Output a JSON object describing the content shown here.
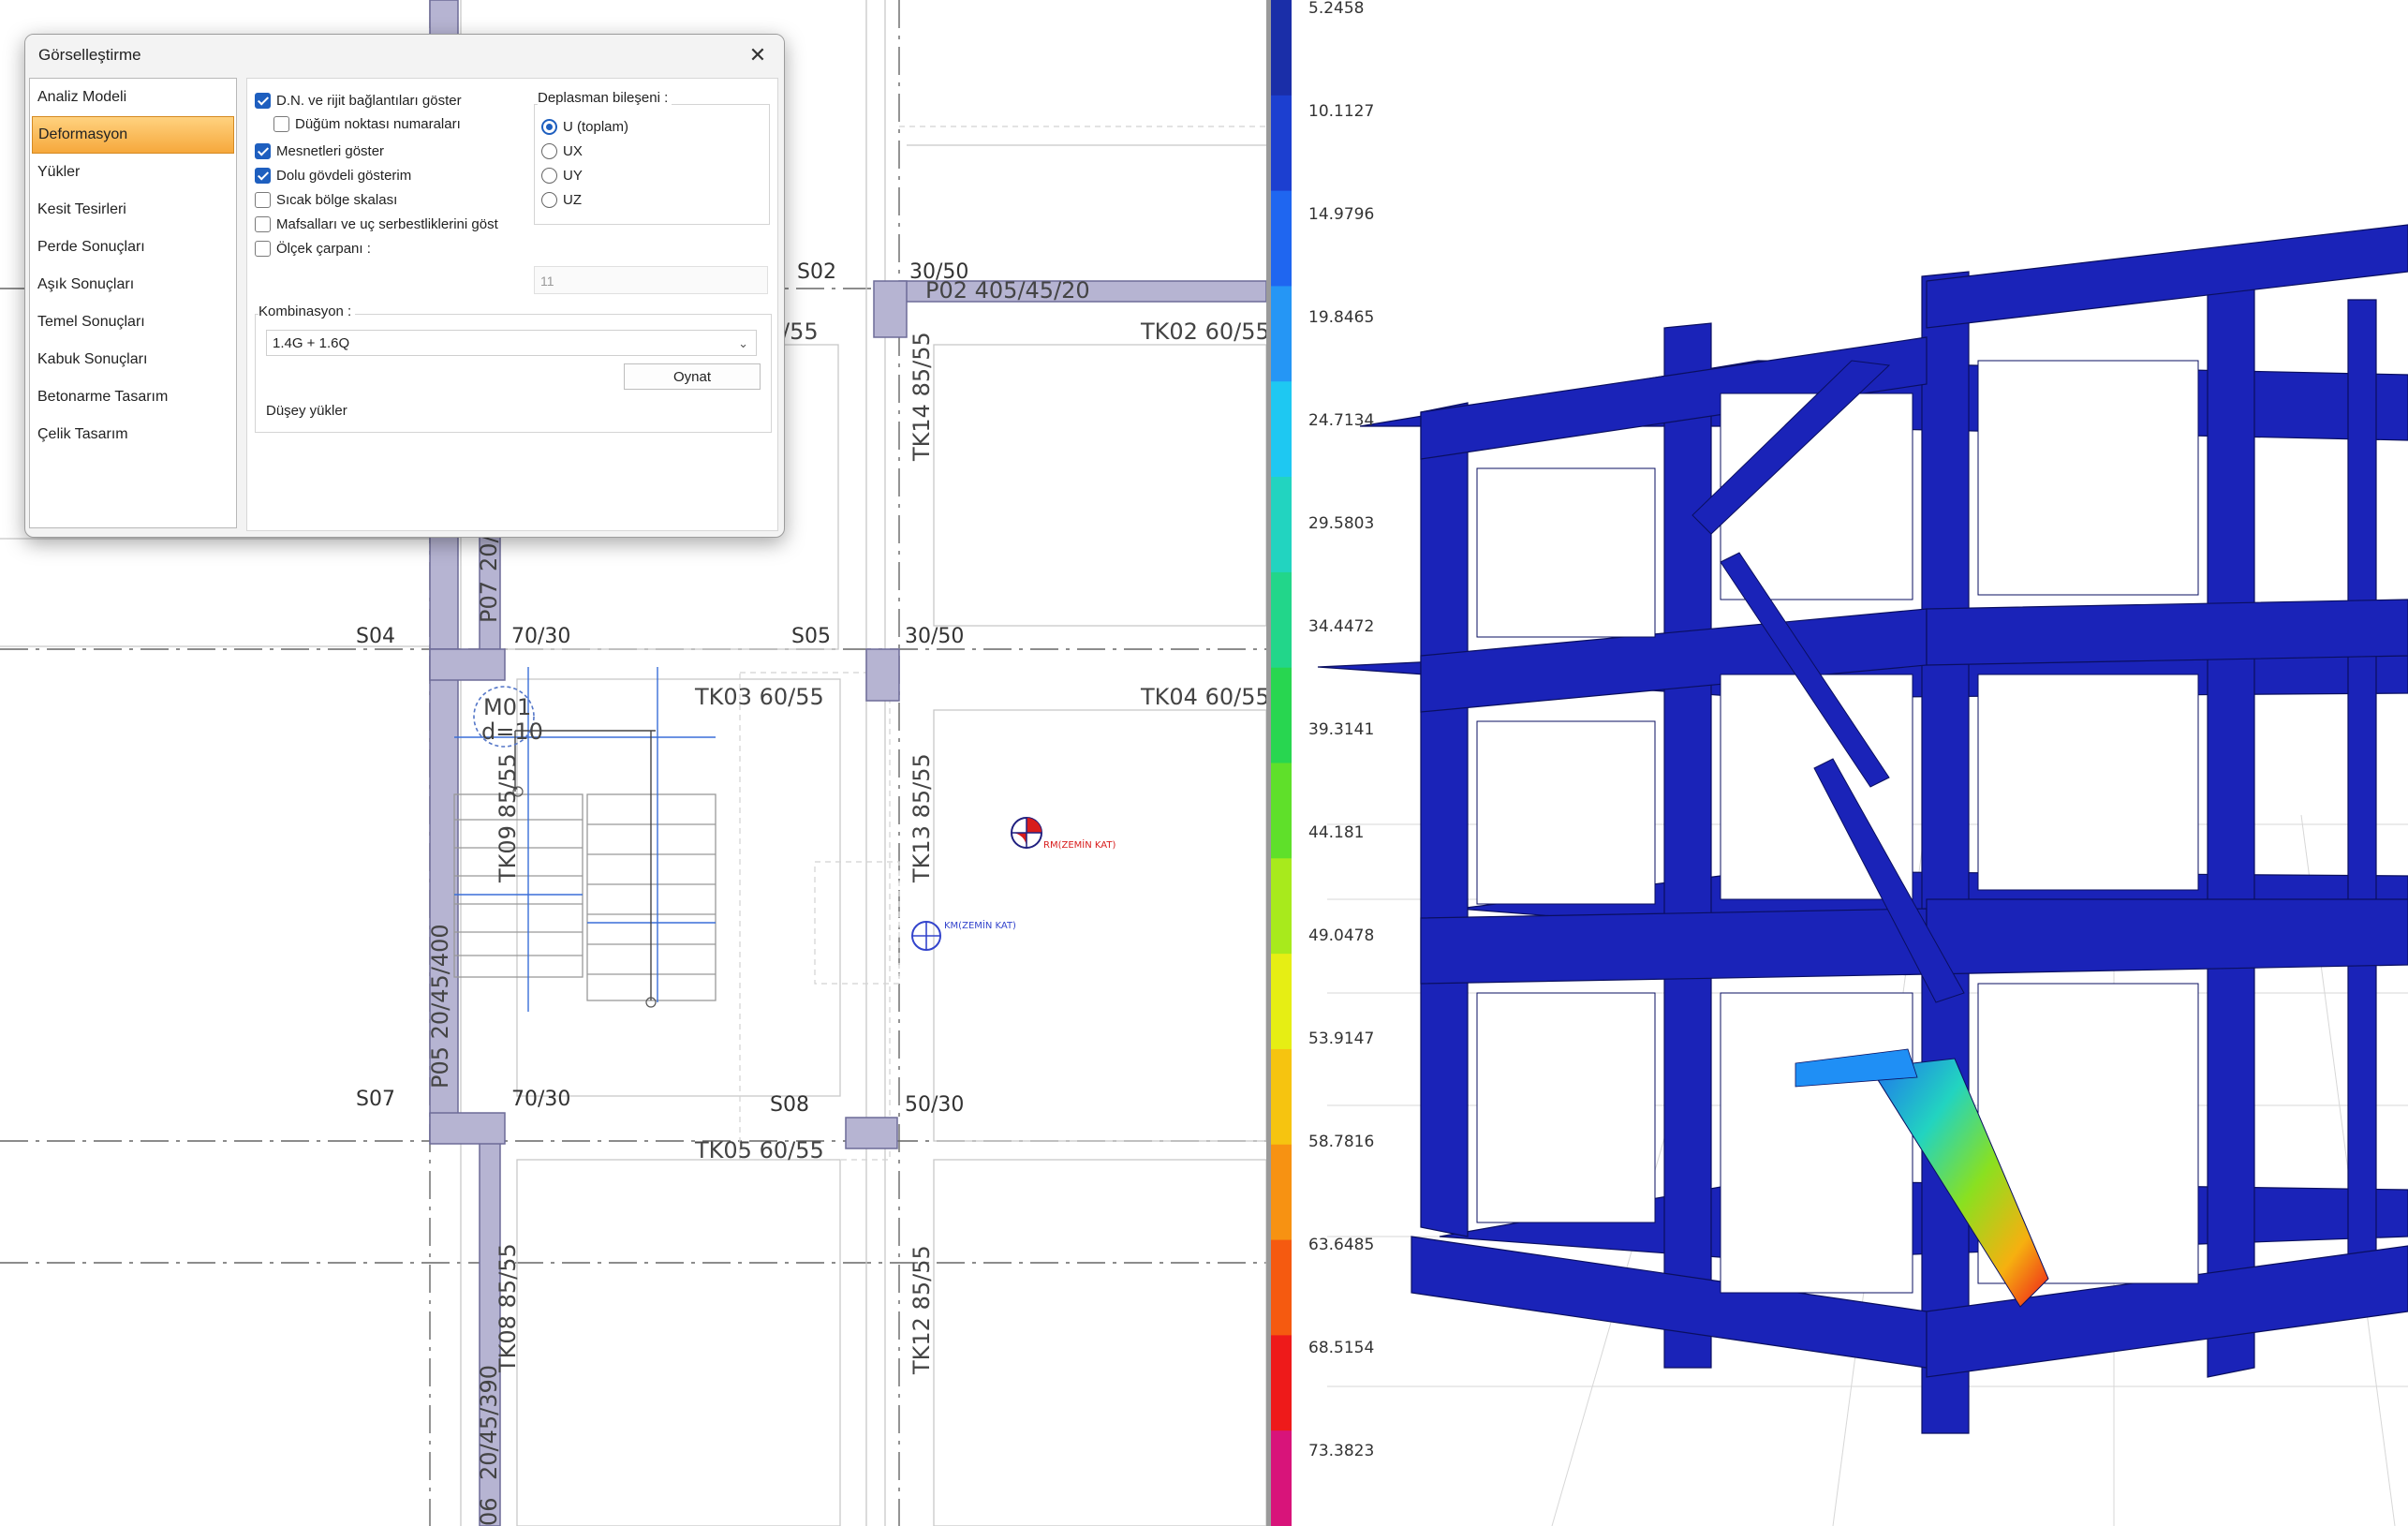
{
  "dialog": {
    "title": "Görselleştirme",
    "close_glyph": "✕",
    "nav": [
      {
        "label": "Analiz Modeli",
        "selected": false
      },
      {
        "label": "Deformasyon",
        "selected": true
      },
      {
        "label": "Yükler",
        "selected": false
      },
      {
        "label": "Kesit Tesirleri",
        "selected": false
      },
      {
        "label": "Perde Sonuçları",
        "selected": false
      },
      {
        "label": "Aşık Sonuçları",
        "selected": false
      },
      {
        "label": "Temel Sonuçları",
        "selected": false
      },
      {
        "label": "Kabuk Sonuçları",
        "selected": false
      },
      {
        "label": "Betonarme Tasarım",
        "selected": false
      },
      {
        "label": "Çelik Tasarım",
        "selected": false
      }
    ],
    "options": [
      {
        "label": "D.N. ve rijit bağlantıları göster",
        "checked": true
      },
      {
        "label": "Düğüm noktası numaraları",
        "checked": false
      },
      {
        "label": "Mesnetleri göster",
        "checked": true
      },
      {
        "label": "Dolu gövdeli gösterim",
        "checked": true
      },
      {
        "label": "Sıcak bölge skalası",
        "checked": false
      },
      {
        "label": "Mafsalları ve uç serbestliklerini  göst",
        "checked": false
      },
      {
        "label": "Ölçek çarpanı :",
        "checked": false
      }
    ],
    "displacement": {
      "title": "Deplasman bileşeni :",
      "options": [
        {
          "label": "U (toplam)",
          "selected": true
        },
        {
          "label": "UX",
          "selected": false
        },
        {
          "label": "UY",
          "selected": false
        },
        {
          "label": "UZ",
          "selected": false
        }
      ]
    },
    "scale_value": "11",
    "combination": {
      "title": "Kombinasyon :",
      "value": "1.4G + 1.6Q",
      "play_label": "Oynat",
      "description": "Düşey yükler"
    }
  },
  "plan": {
    "labels": {
      "s02": "S02",
      "c_30_50_a": "30/50",
      "p02": "P02   405/45/20",
      "tk01_part": "/55",
      "tk02": "TK02 60/55",
      "tk14": "TK14 85/55",
      "p07": "P07",
      "p07b": "20/",
      "s04": "S04",
      "c_70_30_a": "70/30",
      "s05": "S05",
      "c_30_50_b": "30/50",
      "m01": "M01",
      "d10": "d=10",
      "tk03": "TK03 60/55",
      "tk04": "TK04 60/55",
      "tk09": "TK09 85/55",
      "tk13": "TK13 85/55",
      "rm": "RM(ZEMİN KAT)",
      "km": "KM(ZEMİN KAT)",
      "p05": "P05   20/45/400",
      "s07": "S07",
      "c_70_30_b": "70/30",
      "s08": "S08",
      "c_50_30": "50/30",
      "tk05": "TK05 60/55",
      "tk08": "TK08 85/55",
      "tk12": "TK12 85/55",
      "p06": "20/45/390",
      "p06b": "06"
    }
  },
  "legend": {
    "values": [
      "5.2458",
      "10.1127",
      "14.9796",
      "19.8465",
      "24.7134",
      "29.5803",
      "34.4472",
      "39.3141",
      "44.181",
      "49.0478",
      "53.9147",
      "58.7816",
      "63.6485",
      "68.5154",
      "73.3823"
    ],
    "colors": [
      "#1a2ea8",
      "#1c3fd0",
      "#1f66f0",
      "#2596f5",
      "#1ec8f2",
      "#22d4c0",
      "#22d68a",
      "#28d650",
      "#5fe02a",
      "#a8ea1c",
      "#e6ee14",
      "#f6c410",
      "#f79212",
      "#f55a10",
      "#ee1a1a",
      "#d8147a"
    ]
  },
  "model_colors": {
    "structure": "#1a23b8",
    "outline": "#0a0f60"
  }
}
